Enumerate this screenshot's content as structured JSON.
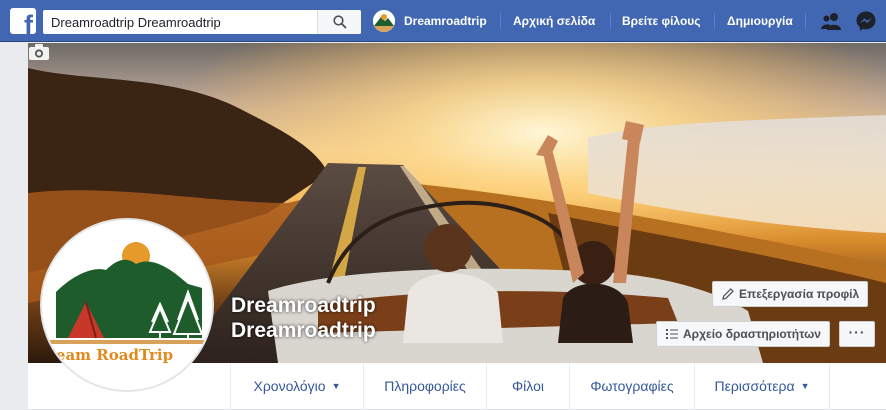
{
  "topbar": {
    "logo": "f",
    "search_value": "Dreamroadtrip Dreamroadtrip",
    "profile_name": "Dreamroadtrip",
    "home": "Αρχική σελίδα",
    "find_friends": "Βρείτε φίλους",
    "create": "Δημιουργία",
    "icons": [
      "search-icon",
      "friend-requests-icon",
      "messenger-icon"
    ],
    "accent_color": "#4267b2"
  },
  "profile": {
    "name_line1": "Dreamroadtrip",
    "name_line2": "Dreamroadtrip",
    "avatar_text": "ream RoadTrip",
    "edit_profile": "Επεξεργασία προφίλ",
    "activity_log": "Αρχείο δραστηριοτήτων",
    "more_dots": "···"
  },
  "tabs": {
    "timeline": "Χρονολόγιο",
    "about": "Πληροφορίες",
    "friends": "Φίλοι",
    "photos": "Φωτογραφίες",
    "more": "Περισσότερα",
    "caret": "▼"
  }
}
